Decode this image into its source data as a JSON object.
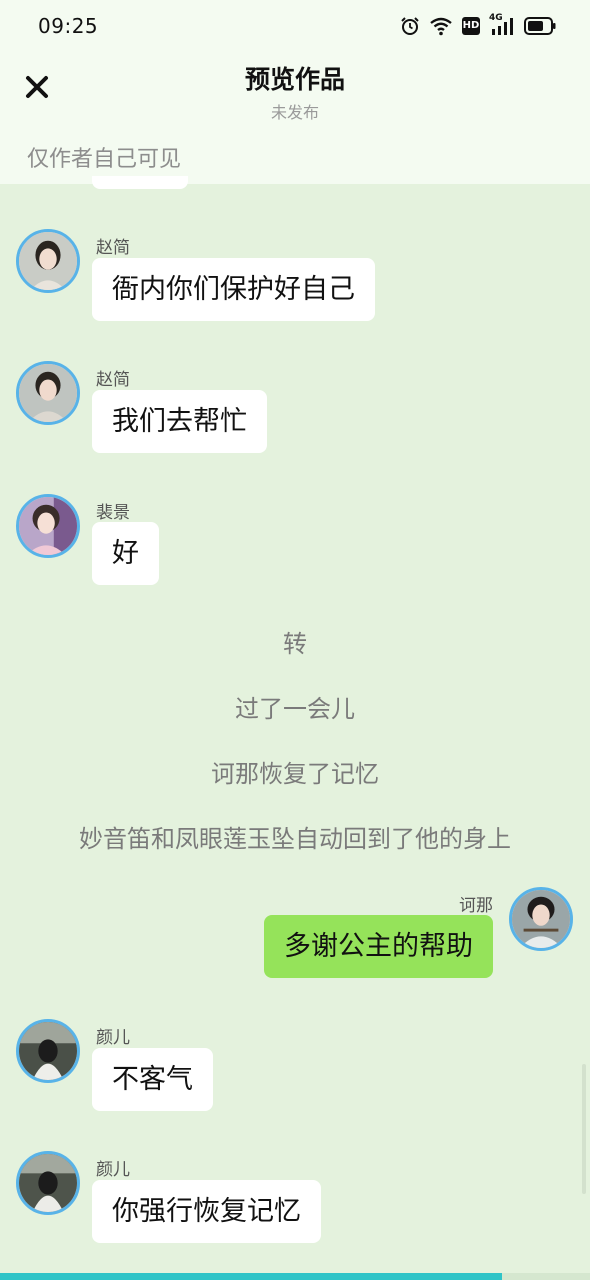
{
  "status_bar": {
    "time": "09:25",
    "icons": [
      "alarm-icon",
      "wifi-icon",
      "hd-icon",
      "4g-signal-icon",
      "battery-icon"
    ],
    "network_label": "4G",
    "hd_label": "HD"
  },
  "header": {
    "close_icon": "close-icon",
    "title": "预览作品",
    "subtitle": "未发布",
    "visibility_note": "仅作者自己可见"
  },
  "messages": [
    {
      "sender": "赵简",
      "text": "衙内你们保护好自己",
      "side": "left",
      "avatar": "avatar-zhaojian"
    },
    {
      "sender": "赵简",
      "text": "我们去帮忙",
      "side": "left",
      "avatar": "avatar-zhaojian"
    },
    {
      "sender": "裴景",
      "text": "好",
      "side": "left",
      "avatar": "avatar-peijing"
    }
  ],
  "narration": [
    "转",
    "过了一会儿",
    "诃那恢复了记忆",
    "妙音笛和凤眼莲玉坠自动回到了他的身上"
  ],
  "messages_after": [
    {
      "sender": "诃那",
      "text": "多谢公主的帮助",
      "side": "right",
      "avatar": "avatar-hena"
    },
    {
      "sender": "颜儿",
      "text": "不客气",
      "side": "left",
      "avatar": "avatar-yaner"
    },
    {
      "sender": "颜儿",
      "text": "你强行恢复记忆",
      "side": "left",
      "avatar": "avatar-yaner"
    }
  ],
  "colors": {
    "chat_background": "#e4f2dd",
    "header_background": "#f4fbf1",
    "my_bubble": "#95e35a",
    "other_bubble": "#ffffff",
    "avatar_ring": "#58b3e8",
    "progress": "#2fc4c7"
  },
  "reading_progress": 0.85
}
